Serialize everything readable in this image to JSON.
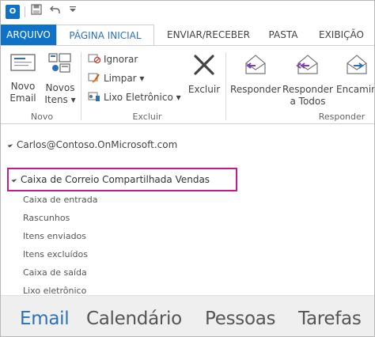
{
  "app": {
    "icon_label": "O"
  },
  "qat": {
    "save_icon": "save-icon",
    "undo_icon": "undo-icon",
    "customize_icon": "customize-icon"
  },
  "tabs": [
    {
      "label": "ARQUIVO"
    },
    {
      "label": "PÁGINA INICIAL"
    },
    {
      "label": "ENVIAR/RECEBER"
    },
    {
      "label": "PASTA"
    },
    {
      "label": "EXIBIÇÃO"
    }
  ],
  "ribbon": {
    "novo": {
      "group_label": "Novo",
      "novo_email": [
        "Novo",
        "Email"
      ],
      "novos_itens": [
        "Novos",
        "Itens ▾"
      ]
    },
    "excluir": {
      "group_label": "Excluir",
      "ignorar": "Ignorar",
      "limpar": "Limpar ▾",
      "lixo": "Lixo Eletrônico ▾",
      "excluir_btn": "Excluir"
    },
    "responder": {
      "group_label": "Responder",
      "responder_btn": "Responder",
      "responder_todos": [
        "Responder",
        "a Todos"
      ],
      "encaminhar": "Encaminhar"
    }
  },
  "nav": {
    "account": "Carlos@Contoso.OnMicrosoft.com",
    "shared_mailbox": "Caixa de Correio Compartilhada Vendas",
    "folders": [
      "Caixa de entrada",
      "Rascunhos",
      "Itens enviados",
      "Itens excluídos",
      "Caixa de saída",
      "Lixo eletrônico"
    ]
  },
  "bottom_nav": [
    "Email",
    "Calendário",
    "Pessoas",
    "Tarefas"
  ],
  "colors": {
    "accent": "#0f72c6",
    "active_tab_text": "#2a72b8",
    "highlight_border": "#c41d87"
  }
}
